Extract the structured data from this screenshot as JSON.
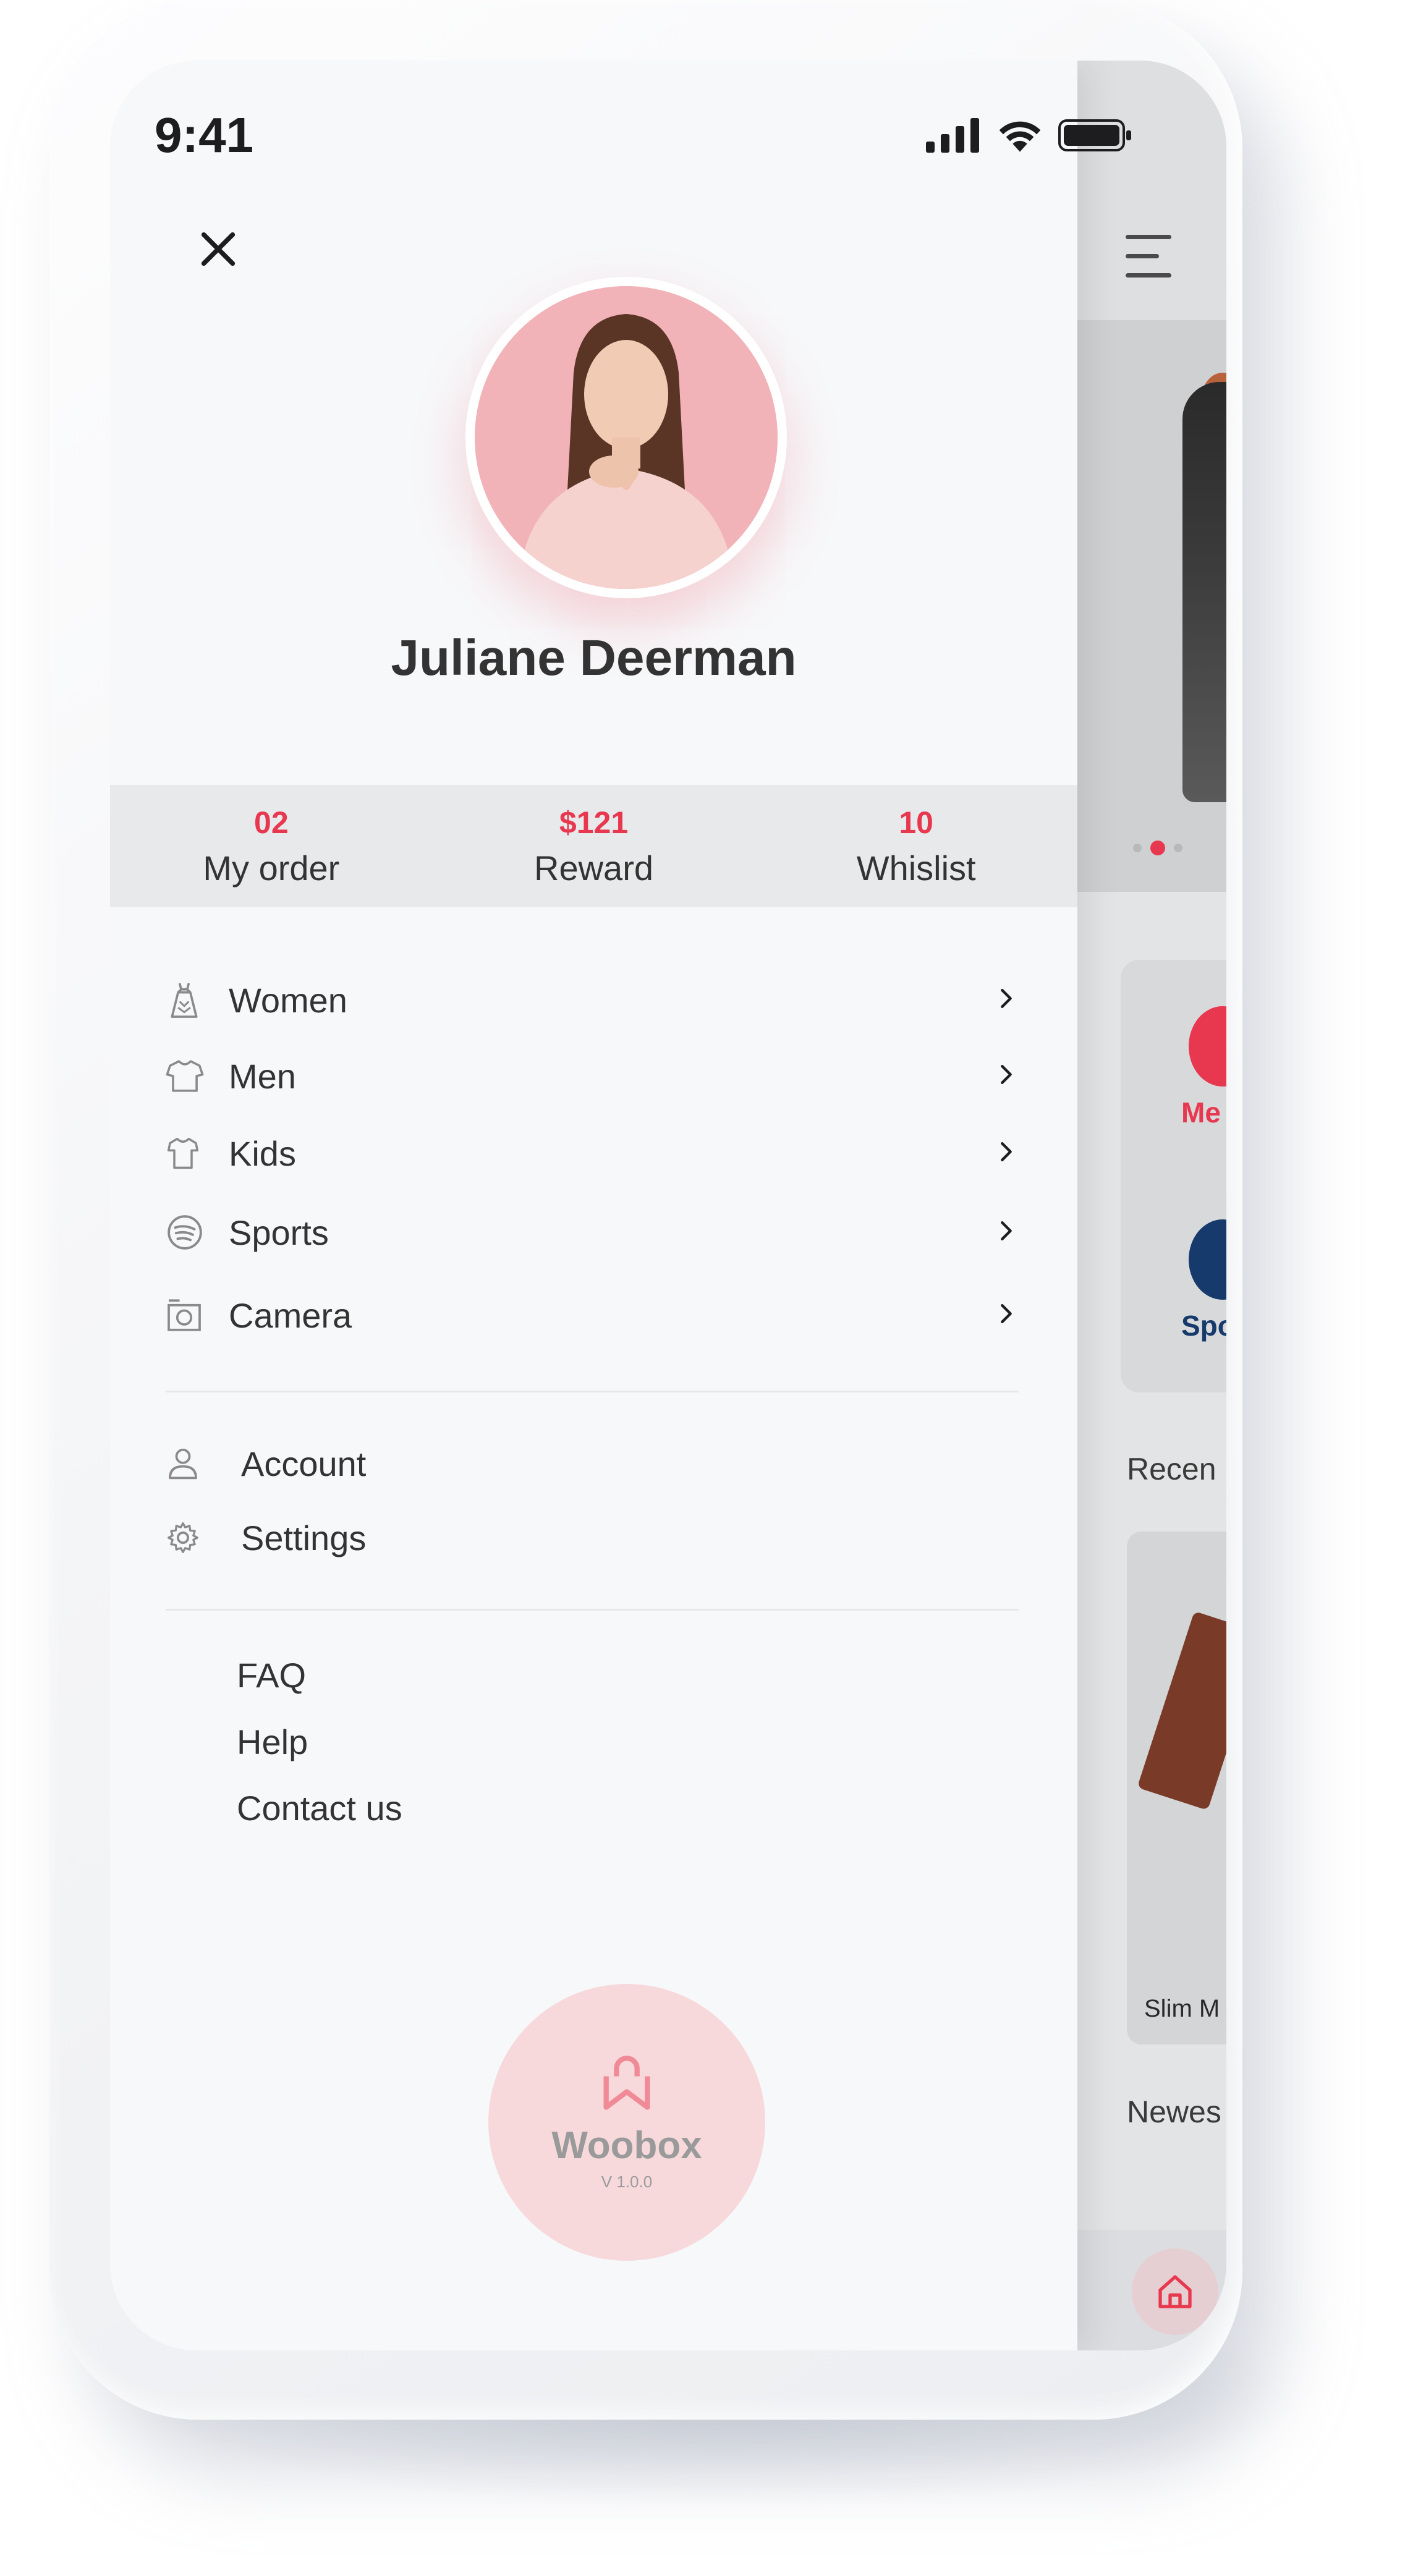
{
  "status_bar": {
    "time": "9:41"
  },
  "profile": {
    "name": "Juliane Deerman"
  },
  "stats": [
    {
      "value": "02",
      "label": "My order"
    },
    {
      "value": "$121",
      "label": "Reward"
    },
    {
      "value": "10",
      "label": "Whislist"
    }
  ],
  "categories": [
    {
      "label": "Women",
      "icon": "dress-icon"
    },
    {
      "label": "Men",
      "icon": "tshirt-icon"
    },
    {
      "label": "Kids",
      "icon": "kids-shirt-icon"
    },
    {
      "label": "Sports",
      "icon": "ball-icon"
    },
    {
      "label": "Camera",
      "icon": "camera-icon"
    }
  ],
  "account_menu": [
    {
      "label": "Account",
      "icon": "user-icon"
    },
    {
      "label": "Settings",
      "icon": "gear-icon"
    }
  ],
  "support_links": [
    "FAQ",
    "Help",
    "Contact us"
  ],
  "brand": {
    "name": "Woobox",
    "version": "V 1.0.0"
  },
  "background_app": {
    "categories": [
      "Me",
      "Spo"
    ],
    "sections": [
      "Recen",
      "Newes"
    ],
    "product_name": "Slim M"
  },
  "colors": {
    "accent": "#e8384f",
    "navy": "#153a6b"
  }
}
